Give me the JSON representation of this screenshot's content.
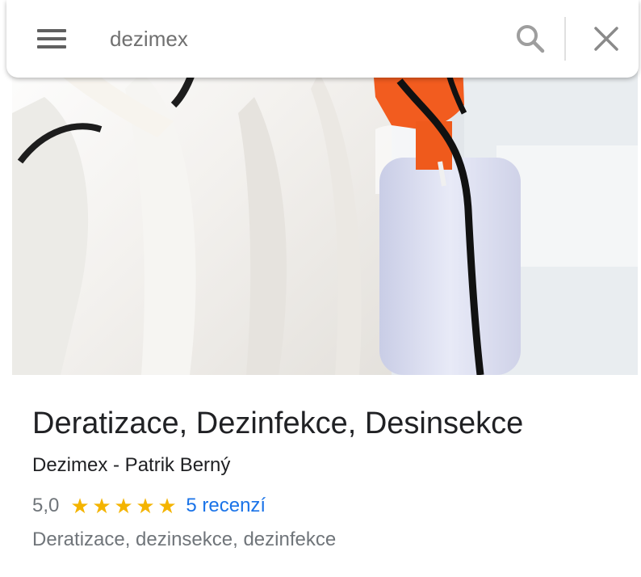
{
  "search": {
    "query": "dezimex",
    "menu_icon": "menu-icon",
    "search_icon": "search-icon",
    "close_icon": "close-icon"
  },
  "place": {
    "photo": "place-photo",
    "title": "Deratizace, Dezinfekce, Desinsekce",
    "subtitle": "Dezimex - Patrik Berný",
    "rating_value": "5,0",
    "stars_filled": 5,
    "stars_total": 5,
    "reviews_label": "5 recenzí",
    "category": "Deratizace, dezinsekce, dezinfekce"
  },
  "colors": {
    "star": "#f4b400",
    "link": "#1a73e8",
    "secondary_text": "#70757a"
  }
}
